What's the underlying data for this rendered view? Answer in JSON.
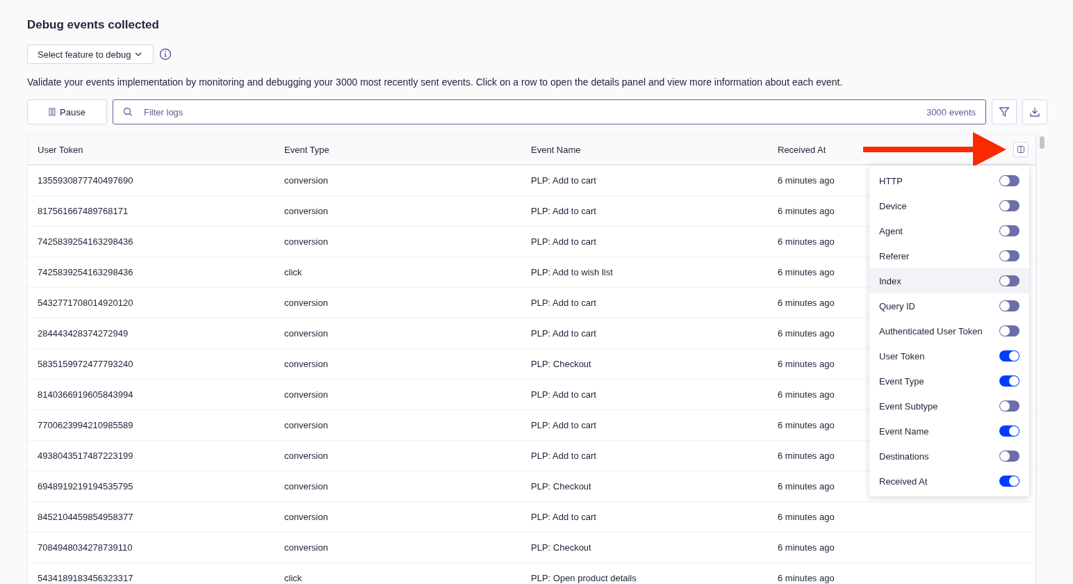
{
  "title": "Debug events collected",
  "feature_select": {
    "label": "Select feature to debug"
  },
  "description": "Validate your events implementation by monitoring and debugging your 3000 most recently sent events. Click on a row to open the details panel and view more information about each event.",
  "toolbar": {
    "pause_label": "Pause",
    "search": {
      "placeholder": "Filter logs"
    },
    "event_count": "3000 events"
  },
  "table": {
    "columns": [
      "User Token",
      "Event Type",
      "Event Name",
      "Received At"
    ],
    "rows": [
      [
        "1355930877740497690",
        "conversion",
        "PLP: Add to cart",
        "6 minutes ago"
      ],
      [
        "817561667489768171",
        "conversion",
        "PLP: Add to cart",
        "6 minutes ago"
      ],
      [
        "7425839254163298436",
        "conversion",
        "PLP: Add to cart",
        "6 minutes ago"
      ],
      [
        "7425839254163298436",
        "click",
        "PLP: Add to wish list",
        "6 minutes ago"
      ],
      [
        "5432771708014920120",
        "conversion",
        "PLP: Add to cart",
        "6 minutes ago"
      ],
      [
        "284443428374272949",
        "conversion",
        "PLP: Add to cart",
        "6 minutes ago"
      ],
      [
        "5835159972477793240",
        "conversion",
        "PLP: Checkout",
        "6 minutes ago"
      ],
      [
        "8140366919605843994",
        "conversion",
        "PLP: Add to cart",
        "6 minutes ago"
      ],
      [
        "7700623994210985589",
        "conversion",
        "PLP: Add to cart",
        "6 minutes ago"
      ],
      [
        "4938043517487223199",
        "conversion",
        "PLP: Add to cart",
        "6 minutes ago"
      ],
      [
        "6948919219194535795",
        "conversion",
        "PLP: Checkout",
        "6 minutes ago"
      ],
      [
        "8452104459854958377",
        "conversion",
        "PLP: Add to cart",
        "6 minutes ago"
      ],
      [
        "7084948034278739110",
        "conversion",
        "PLP: Checkout",
        "6 minutes ago"
      ],
      [
        "5434189183456323317",
        "click",
        "PLP: Open product details",
        "6 minutes ago"
      ]
    ]
  },
  "column_menu": [
    {
      "label": "HTTP",
      "on": false,
      "hovered": false
    },
    {
      "label": "Device",
      "on": false,
      "hovered": false
    },
    {
      "label": "Agent",
      "on": false,
      "hovered": false
    },
    {
      "label": "Referer",
      "on": false,
      "hovered": false
    },
    {
      "label": "Index",
      "on": false,
      "hovered": true
    },
    {
      "label": "Query ID",
      "on": false,
      "hovered": false
    },
    {
      "label": "Authenticated User Token",
      "on": false,
      "hovered": false
    },
    {
      "label": "User Token",
      "on": true,
      "hovered": false
    },
    {
      "label": "Event Type",
      "on": true,
      "hovered": false
    },
    {
      "label": "Event Subtype",
      "on": false,
      "hovered": false
    },
    {
      "label": "Event Name",
      "on": true,
      "hovered": false
    },
    {
      "label": "Destinations",
      "on": false,
      "hovered": false
    },
    {
      "label": "Received At",
      "on": true,
      "hovered": false
    }
  ]
}
